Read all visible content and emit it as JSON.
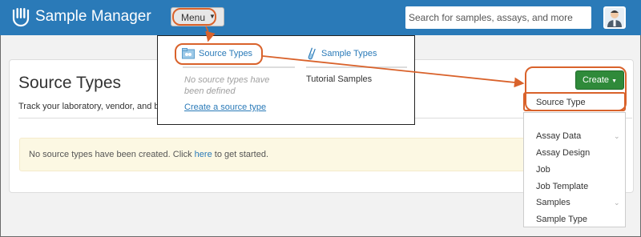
{
  "header": {
    "app_title": "Sample Manager",
    "search_placeholder": "Search for samples, assays, and more"
  },
  "menu_button": {
    "label": "Menu"
  },
  "menu": {
    "source_types_heading": "Source Types",
    "source_types_empty": "No source types have been defined",
    "create_source_type_link": "Create a source type",
    "sample_types_heading": "Sample Types",
    "sample_types_items": [
      "Tutorial Samples"
    ]
  },
  "page": {
    "title": "Source Types",
    "subtitle": "Track your laboratory, vendor, and biological sources"
  },
  "alert": {
    "text_before": "No source types have been created. Click ",
    "link_text": "here",
    "text_after": " to get started."
  },
  "create": {
    "button_label": "Create",
    "items": [
      {
        "label": "Source Type",
        "has_submenu": false
      },
      {
        "label": "Assay Data",
        "has_submenu": true
      },
      {
        "label": "Assay Design",
        "has_submenu": false
      },
      {
        "label": "Job",
        "has_submenu": false
      },
      {
        "label": "Job Template",
        "has_submenu": false
      },
      {
        "label": "Samples",
        "has_submenu": true
      },
      {
        "label": "Sample Type",
        "has_submenu": false
      }
    ]
  },
  "colors": {
    "header": "#2a7ab8",
    "create_button": "#2f8a3a",
    "callout": "#d9622b",
    "alert_bg": "#fcf8e3"
  },
  "icons": {
    "logo": "sample-manager-logo",
    "user": "user-avatar-icon",
    "caret": "caret-down-icon",
    "source_types": "source-types-icon",
    "sample_types": "test-tube-icon",
    "submenu": "chevron-down-icon"
  }
}
